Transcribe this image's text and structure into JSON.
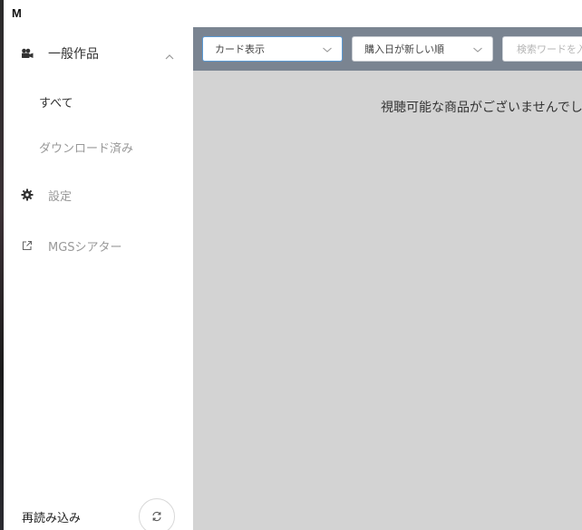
{
  "app": {
    "logo_text": "M",
    "logo_dot": "●"
  },
  "sidebar": {
    "section": {
      "label": "一般作品",
      "icon": "movie-camera-icon",
      "expanded": true
    },
    "sub_items": [
      {
        "label": "すべて"
      },
      {
        "label": "ダウンロード済み"
      }
    ],
    "settings": {
      "label": "設定",
      "icon": "gear-icon"
    },
    "theater": {
      "label": "MGSシアター",
      "icon": "external-link-icon"
    },
    "reload": {
      "label": "再読み込み",
      "icon": "refresh-icon"
    }
  },
  "toolbar": {
    "view_select": {
      "value": "カード表示"
    },
    "sort_select": {
      "value": "購入日が新しい順"
    },
    "search": {
      "placeholder": "検索ワードを入"
    }
  },
  "main": {
    "empty_message": "視聴可能な商品がございませんでし"
  },
  "colors": {
    "toolbar_bg": "#7a8491",
    "content_bg": "#d3d3d3",
    "focus_border": "#5b9bd5"
  }
}
